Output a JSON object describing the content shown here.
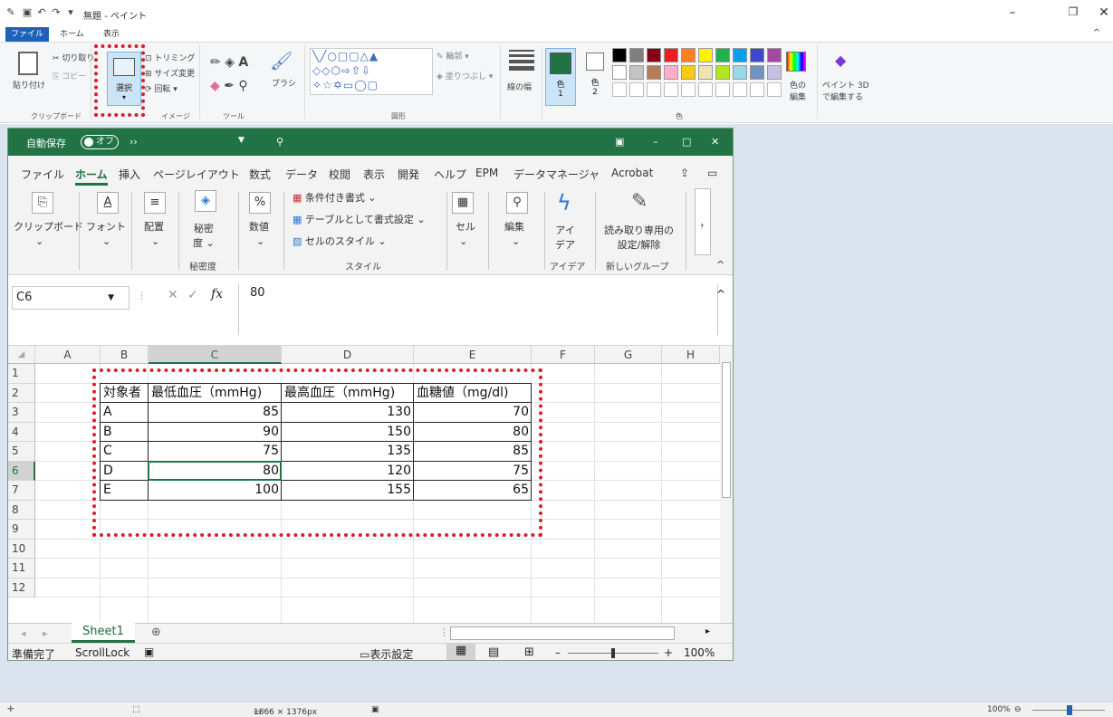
{
  "paint": {
    "title": "無題 - ペイント",
    "tabs": [
      "ファイル",
      "ホーム",
      "表示"
    ],
    "clipboard": {
      "paste": "貼り付け",
      "cut": "切り取り",
      "copy": "コピー",
      "group": "クリップボード"
    },
    "image": {
      "select": "選択",
      "crop": "トリミング",
      "resize": "サイズ変更",
      "rotate": "回転",
      "group": "イメージ"
    },
    "tools": {
      "group": "ツール",
      "brush": "ブラシ"
    },
    "shapes": {
      "outline": "輪郭",
      "fill": "塗りつぶし",
      "group": "図形"
    },
    "size_label": "線の幅",
    "color1": "色\n1",
    "color1_a": "色",
    "color1_b": "1",
    "color2_a": "色",
    "color2_b": "2",
    "edit_colors": "色の編集",
    "edit_colors_a": "色の",
    "edit_colors_b": "編集",
    "paint3d_a": "ペイント 3D",
    "paint3d_b": "で編集する",
    "colors_group": "色",
    "palette_row1": [
      "#000000",
      "#7f7f7f",
      "#880015",
      "#ed1c24",
      "#ff7f27",
      "#fff200",
      "#22b14c",
      "#00a2e8",
      "#3f48cc",
      "#a349a4"
    ],
    "palette_row2": [
      "#ffffff",
      "#c3c3c3",
      "#b97a57",
      "#ffaec9",
      "#ffc90e",
      "#efe4b0",
      "#b5e61d",
      "#99d9ea",
      "#7092be",
      "#c8bfe7"
    ],
    "color1_value": "#217346",
    "status_dims": "1866 × 1376px",
    "zoom": "100%"
  },
  "excel": {
    "autosave": "自動保存",
    "autosave_state": "オフ",
    "tabs": [
      "ファイル",
      "ホーム",
      "挿入",
      "ページレイアウト",
      "数式",
      "データ",
      "校閲",
      "表示",
      "開発",
      "ヘルプ",
      "EPM",
      "データマネージャ",
      "Acrobat"
    ],
    "ribbon": {
      "clipboard": "クリップボード",
      "font": "フォント",
      "align": "配置",
      "secret_a": "秘密",
      "secret_b": "度",
      "number": "数値",
      "cond_format": "条件付き書式",
      "table_format": "テーブルとして書式設定",
      "cell_style": "セルのスタイル",
      "cells": "セル",
      "edit": "編集",
      "ideas_a": "アイ",
      "ideas_b": "デア",
      "readonly_a": "読み取り専用の",
      "readonly_b": "設定/解除",
      "grp_secret": "秘密度",
      "grp_style": "スタイル",
      "grp_ideas": "アイデア",
      "grp_new": "新しいグループ"
    },
    "name_box": "C6",
    "formula_value": "80",
    "columns": [
      "A",
      "B",
      "C",
      "D",
      "E",
      "F",
      "G",
      "H"
    ],
    "rows": [
      "1",
      "2",
      "3",
      "4",
      "5",
      "6",
      "7",
      "8",
      "9",
      "10",
      "11",
      "12"
    ],
    "table": {
      "headers": [
        "対象者",
        "最低血圧（mmHg)",
        "最高血圧（mmHg)",
        "血糖値（mg/dl)"
      ],
      "data": [
        [
          "A",
          "85",
          "130",
          "70"
        ],
        [
          "B",
          "90",
          "150",
          "80"
        ],
        [
          "C",
          "75",
          "135",
          "85"
        ],
        [
          "D",
          "80",
          "120",
          "75"
        ],
        [
          "E",
          "100",
          "155",
          "65"
        ]
      ]
    },
    "sheet": "Sheet1",
    "status": {
      "ready": "準備完了",
      "scroll": "ScrollLock",
      "display": "表示設定",
      "zoom": "100%"
    }
  }
}
